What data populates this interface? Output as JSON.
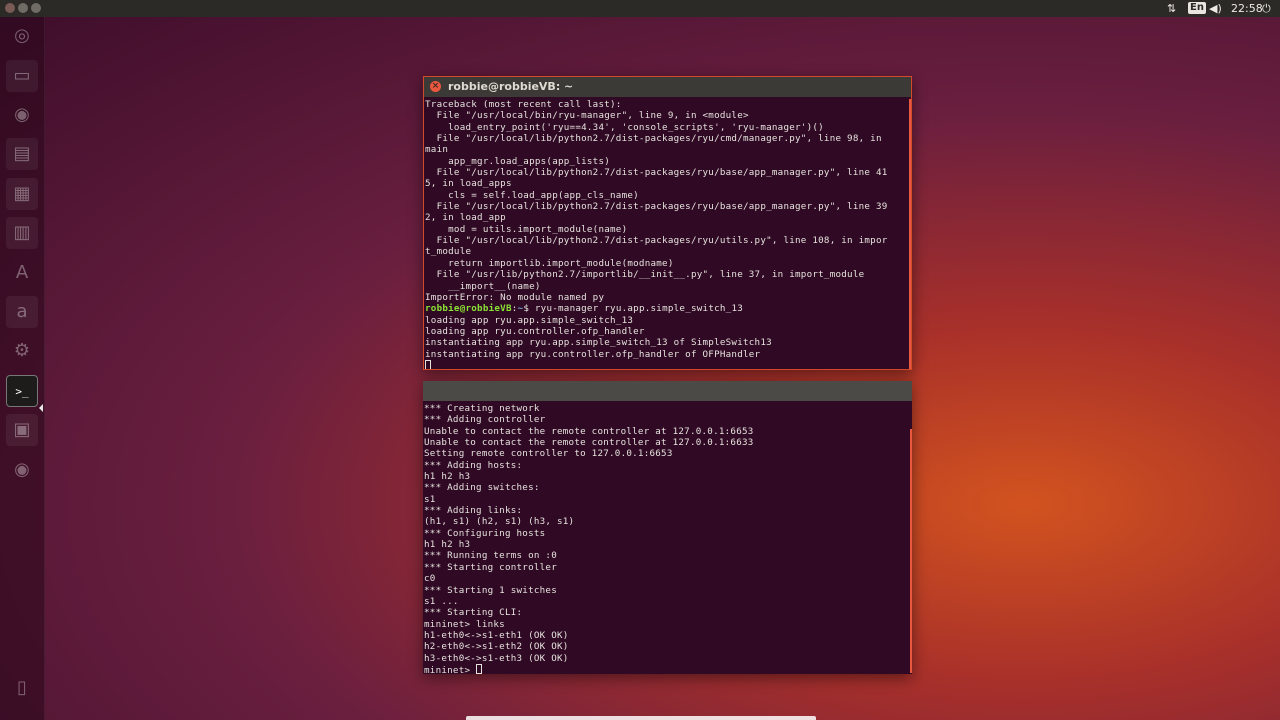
{
  "panel": {
    "time": "22:58",
    "keyboard_layout": "En",
    "icons": [
      "network-updown-icon",
      "keyboard-icon",
      "volume-icon",
      "settings-gear-icon"
    ]
  },
  "launcher": {
    "icons": [
      "ubuntu-dash-icon",
      "files-icon",
      "firefox-icon",
      "libreoffice-writer-icon",
      "libreoffice-calc-icon",
      "libreoffice-impress-icon",
      "software-center-icon",
      "amazon-icon",
      "system-settings-icon",
      "terminal-icon",
      "system-monitor-icon",
      "dvd-icon",
      "trash-icon"
    ],
    "glyphs": [
      "◎",
      "▭",
      "◉",
      "▤",
      "▦",
      "▥",
      "A",
      "a",
      "⚙",
      ">_",
      "▣",
      "◉",
      "▯"
    ]
  },
  "terminal1": {
    "title": "robbie@robbieVB: ~",
    "lines": [
      {
        "text": "Traceback (most recent call last):"
      },
      {
        "text": "  File \"/usr/local/bin/ryu-manager\", line 9, in <module>"
      },
      {
        "text": "    load_entry_point('ryu==4.34', 'console_scripts', 'ryu-manager')()"
      },
      {
        "text": "  File \"/usr/local/lib/python2.7/dist-packages/ryu/cmd/manager.py\", line 98, in"
      },
      {
        "text": "main"
      },
      {
        "text": "    app_mgr.load_apps(app_lists)"
      },
      {
        "text": "  File \"/usr/local/lib/python2.7/dist-packages/ryu/base/app_manager.py\", line 41"
      },
      {
        "text": "5, in load_apps"
      },
      {
        "text": "    cls = self.load_app(app_cls_name)"
      },
      {
        "text": "  File \"/usr/local/lib/python2.7/dist-packages/ryu/base/app_manager.py\", line 39"
      },
      {
        "text": "2, in load_app"
      },
      {
        "text": "    mod = utils.import_module(name)"
      },
      {
        "text": "  File \"/usr/local/lib/python2.7/dist-packages/ryu/utils.py\", line 108, in impor"
      },
      {
        "text": "t_module"
      },
      {
        "text": "    return importlib.import_module(modname)"
      },
      {
        "text": "  File \"/usr/lib/python2.7/importlib/__init__.py\", line 37, in import_module"
      },
      {
        "text": "    __import__(name)"
      },
      {
        "text": "ImportError: No module named py"
      },
      {
        "user": "robbie@robbieVB",
        "path": "~",
        "text": "$ ryu-manager ryu.app.simple_switch_13"
      },
      {
        "text": "loading app ryu.app.simple_switch_13"
      },
      {
        "text": "loading app ryu.controller.ofp_handler"
      },
      {
        "text": "instantiating app ryu.app.simple_switch_13 of SimpleSwitch13"
      },
      {
        "text": "instantiating app ryu.controller.ofp_handler of OFPHandler"
      }
    ]
  },
  "terminal2": {
    "title": "",
    "lines": [
      "*** Creating network",
      "*** Adding controller",
      "Unable to contact the remote controller at 127.0.0.1:6653",
      "Unable to contact the remote controller at 127.0.0.1:6633",
      "Setting remote controller to 127.0.0.1:6653",
      "*** Adding hosts:",
      "h1 h2 h3",
      "*** Adding switches:",
      "s1",
      "*** Adding links:",
      "(h1, s1) (h2, s1) (h3, s1)",
      "*** Configuring hosts",
      "h1 h2 h3",
      "*** Running terms on :0",
      "*** Starting controller",
      "c0",
      "*** Starting 1 switches",
      "s1 ...",
      "*** Starting CLI:",
      "mininet> links",
      "h1-eth0<->s1-eth1 (OK OK)",
      "h2-eth0<->s1-eth2 (OK OK)",
      "h3-eth0<->s1-eth3 (OK OK)"
    ],
    "prompt": "mininet> "
  }
}
